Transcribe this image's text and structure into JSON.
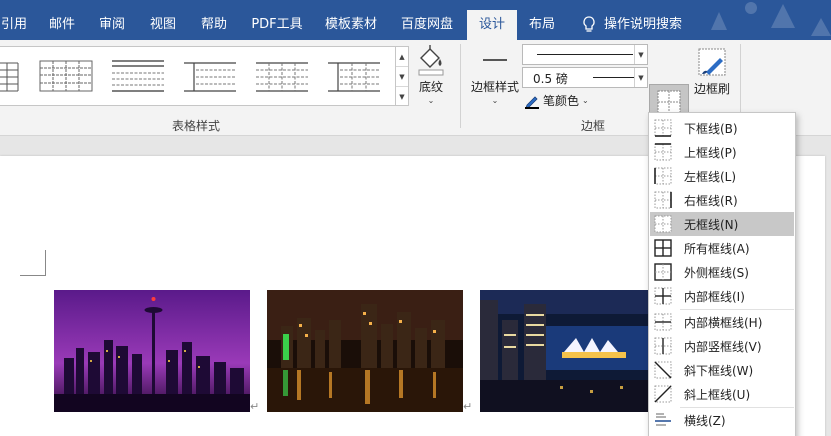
{
  "tabs": [
    {
      "label": "引用",
      "active": false
    },
    {
      "label": "邮件",
      "active": false
    },
    {
      "label": "审阅",
      "active": false
    },
    {
      "label": "视图",
      "active": false
    },
    {
      "label": "帮助",
      "active": false
    },
    {
      "label": "PDF工具",
      "active": false
    },
    {
      "label": "模板素材",
      "active": false
    },
    {
      "label": "百度网盘",
      "active": false
    },
    {
      "label": "设计",
      "active": true
    },
    {
      "label": "布局",
      "active": false
    }
  ],
  "tell_me": "操作说明搜索",
  "ribbon": {
    "table_styles_label": "表格样式",
    "shading_label": "底纹",
    "border_styles_label": "边框样式",
    "pen_weight": "0.5 磅",
    "pen_color_label": "笔颜色",
    "borders_button_label": "边框",
    "border_painter_label": "边框刷",
    "borders_group_label": "边框"
  },
  "border_menu": {
    "items": [
      {
        "label": "下框线(B)",
        "icon": "border-bottom-icon"
      },
      {
        "label": "上框线(P)",
        "icon": "border-top-icon"
      },
      {
        "label": "左框线(L)",
        "icon": "border-left-icon"
      },
      {
        "label": "右框线(R)",
        "icon": "border-right-icon"
      },
      {
        "label": "无框线(N)",
        "icon": "border-none-icon",
        "selected": true
      },
      {
        "label": "所有框线(A)",
        "icon": "border-all-icon"
      },
      {
        "label": "外侧框线(S)",
        "icon": "border-outside-icon"
      },
      {
        "label": "内部框线(I)",
        "icon": "border-inside-icon"
      },
      {
        "label": "内部横框线(H)",
        "icon": "border-inside-horizontal-icon"
      },
      {
        "label": "内部竖框线(V)",
        "icon": "border-inside-vertical-icon"
      },
      {
        "label": "斜下框线(W)",
        "icon": "diagonal-down-icon"
      },
      {
        "label": "斜上框线(U)",
        "icon": "diagonal-up-icon"
      },
      {
        "label": "横线(Z)",
        "icon": "horizontal-line-icon"
      }
    ]
  },
  "colors": {
    "accent": "#2b579a",
    "ribbon_bg": "#f3f3f3",
    "selected_item": "#c8c8c8"
  }
}
